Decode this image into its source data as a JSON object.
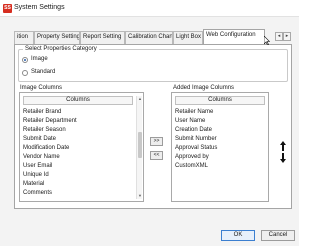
{
  "window": {
    "title": "System Settings",
    "app_icon_text": "SS"
  },
  "tabs": [
    {
      "label": "ition"
    },
    {
      "label": "Property Settings"
    },
    {
      "label": "Report Setting"
    },
    {
      "label": "Calibration Chart"
    },
    {
      "label": "Light Box"
    },
    {
      "label": "Web Configuration",
      "active": true
    }
  ],
  "tab_scroll": {
    "left": "◂",
    "right": "▸"
  },
  "category": {
    "caption": "Select Properties Category",
    "options": [
      {
        "label": "Image",
        "selected": true
      },
      {
        "label": "Standard",
        "selected": false
      }
    ]
  },
  "image_columns": {
    "caption": "Image Columns",
    "header": "Columns",
    "items": [
      "Retailer Brand",
      "Retailer Department",
      "Retailer Season",
      "Submit Date",
      "Modification Date",
      "Vendor Name",
      "User Email",
      "Unique Id",
      "Material",
      "Comments"
    ]
  },
  "added_columns": {
    "caption": "Added Image Columns",
    "header": "Columns",
    "items": [
      "Retailer Name",
      "User Name",
      "Creation Date",
      "Submit Number",
      "Approval Status",
      "Approved by",
      "CustomXML"
    ]
  },
  "move_buttons": {
    "add": ">>",
    "remove": "<<"
  },
  "footer": {
    "ok": "OK",
    "cancel": "Cancel"
  },
  "colors": {
    "accent": "#3c7fd0",
    "app_icon": "#d62d20"
  }
}
